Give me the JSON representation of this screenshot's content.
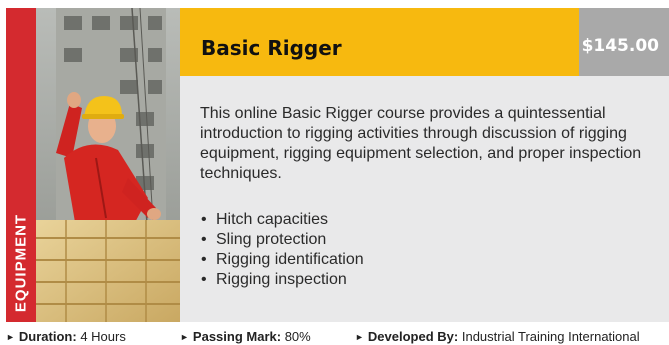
{
  "course": {
    "category": "EQUIPMENT",
    "title": "Basic Rigger",
    "price": "$145.00",
    "description": "This online Basic Rigger course provides a quintessential introduction to rigging activities through discussion of rigging equipment, rigging equipment selection, and proper inspection techniques.",
    "topics": [
      "Hitch capacities",
      "Sling protection",
      "Rigging identification",
      "Rigging inspection"
    ]
  },
  "meta": {
    "duration_label": "Duration:",
    "duration_value": "4 Hours",
    "passing_label": "Passing Mark:",
    "passing_value": "80%",
    "developer_label": "Developed By:",
    "developer_value": "Industrial Training International"
  },
  "icons": {
    "bullet": "bullet-dot-icon",
    "meta_arrow": "triangle-right-icon"
  },
  "colors": {
    "category_strip": "#d42a2f",
    "title_bar": "#f7b90f",
    "price_box": "#a9a9a9",
    "body_panel": "#e9e9ea"
  }
}
